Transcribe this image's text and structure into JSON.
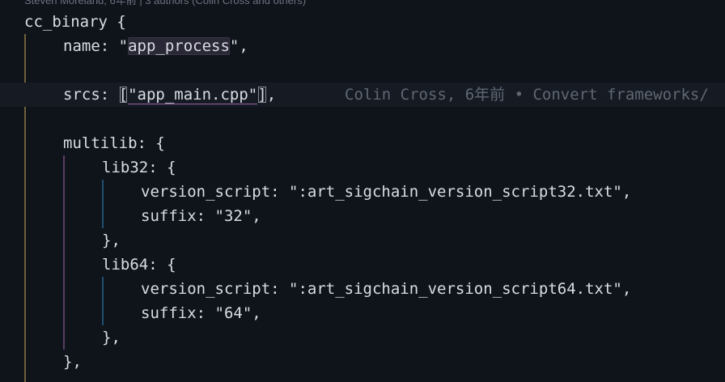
{
  "editor": {
    "codelens": "Steven Moreland, 6年前 | 3 authors (Colin Cross and others)",
    "blame": "Colin Cross, 6年前 • Convert frameworks/",
    "lines": {
      "l1": {
        "a": "cc_binary {"
      },
      "l2": {
        "a": "name: \"",
        "b": "app_process",
        "c": "\","
      },
      "l4": {
        "a": "srcs: ",
        "b": "[",
        "c": "\"app_main.cpp\"",
        "d": "]",
        "e": ","
      },
      "l6": {
        "a": "multilib: {"
      },
      "l7": {
        "a": "lib32: {"
      },
      "l8": {
        "a": "version_script: \":art_sigchain_version_script32.txt\","
      },
      "l9": {
        "a": "suffix: \"32\","
      },
      "l10": {
        "a": "},"
      },
      "l11": {
        "a": "lib64: {"
      },
      "l12": {
        "a": "version_script: \":art_sigchain_version_script64.txt\","
      },
      "l13": {
        "a": "suffix: \"64\","
      },
      "l14": {
        "a": "},"
      },
      "l15": {
        "a": "},"
      }
    }
  }
}
